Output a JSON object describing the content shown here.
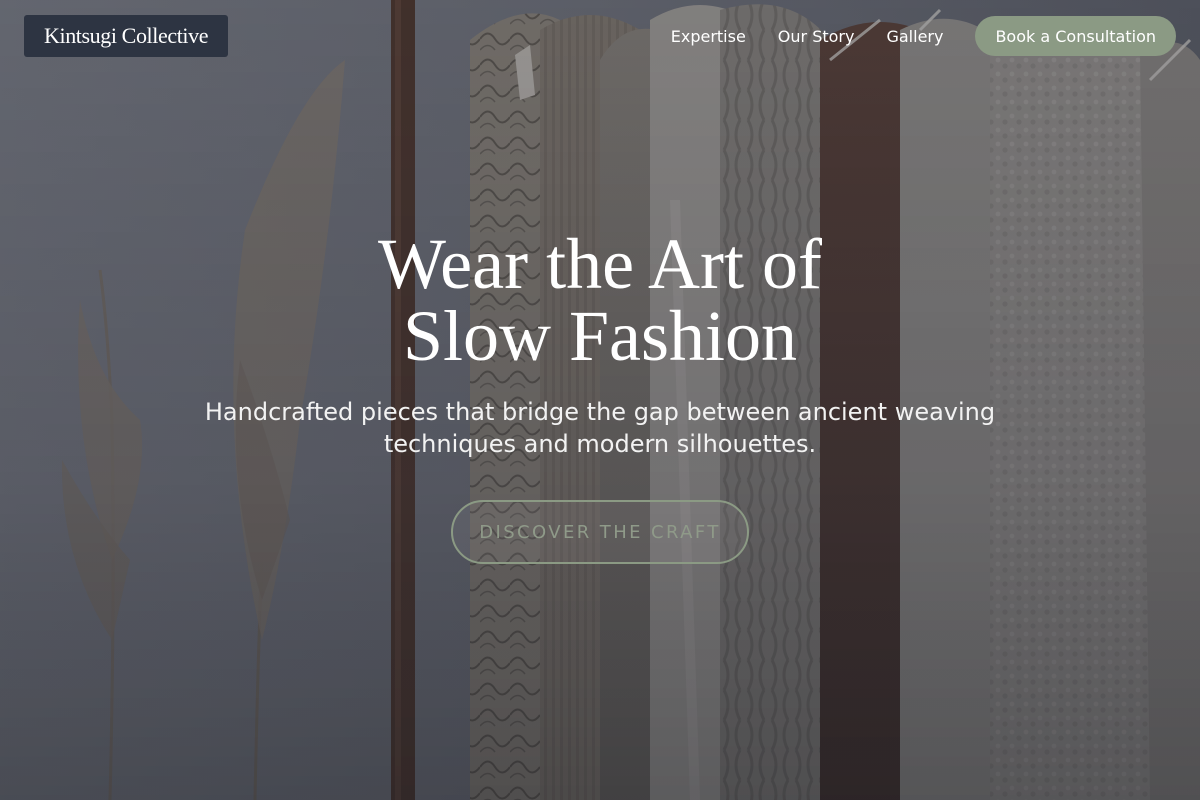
{
  "header": {
    "brand": "Kintsugi Collective",
    "nav": [
      {
        "label": "Expertise"
      },
      {
        "label": "Our Story"
      },
      {
        "label": "Gallery"
      }
    ],
    "cta_label": "Book a Consultation"
  },
  "hero": {
    "title": "Wear the Art of Slow Fashion",
    "subtitle": "Handcrafted pieces that bridge the gap between ancient weaving techniques and modern silhouettes.",
    "button_label": "DISCOVER THE CRAFT"
  },
  "colors": {
    "brand_bg": "#2d3442",
    "accent_sage": "#8b9a84",
    "text_white": "#ffffff"
  },
  "icons": []
}
